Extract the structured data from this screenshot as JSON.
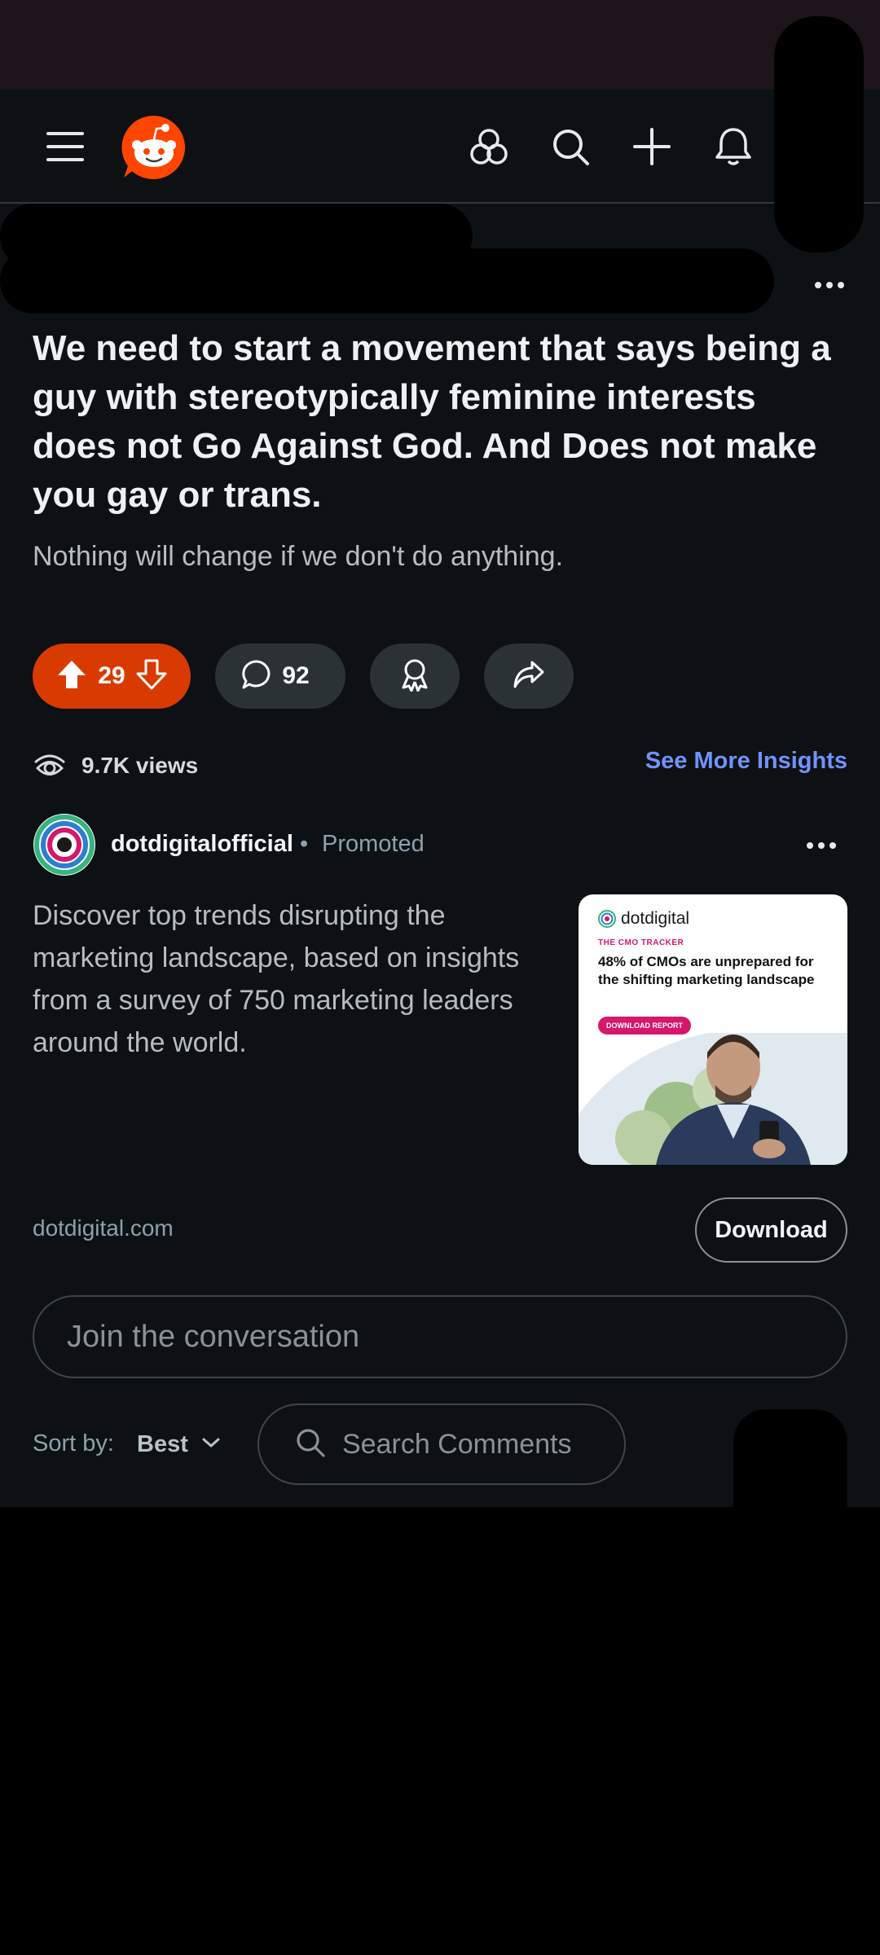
{
  "header": {
    "menu_icon": "menu-icon",
    "logo_icon": "reddit-logo",
    "games_icon": "games-icon",
    "search_icon": "search-icon",
    "create_icon": "plus-icon",
    "notifications_icon": "bell-icon"
  },
  "post": {
    "title": "We need to start a movement that says being a guy with stereotypically feminine interests does not Go Against God. And Does not make you gay or trans.",
    "body": "Nothing will change if we don't do anything.",
    "upvotes": "29",
    "comments": "92",
    "views": "9.7K views",
    "insights_link": "See More Insights"
  },
  "ad": {
    "advertiser": "dotdigitalofficial",
    "separator": "•",
    "promoted_label": "Promoted",
    "text": "Discover top trends disrupting the marketing landscape, based on insights from a survey of 750 marketing leaders around the world.",
    "image": {
      "brand": "dotdigital",
      "kicker": "THE CMO TRACKER",
      "headline": "48% of CMOs are unprepared for the shifting marketing landscape",
      "cta": "DOWNLOAD REPORT"
    },
    "domain": "dotdigital.com",
    "cta_label": "Download"
  },
  "comments": {
    "join_placeholder": "Join the conversation",
    "sort_label": "Sort by:",
    "sort_value": "Best",
    "search_placeholder": "Search Comments"
  },
  "colors": {
    "background": "#0e1113",
    "upvote_pill": "#d93a00",
    "link": "#7193ff",
    "pill": "#2a3236"
  }
}
